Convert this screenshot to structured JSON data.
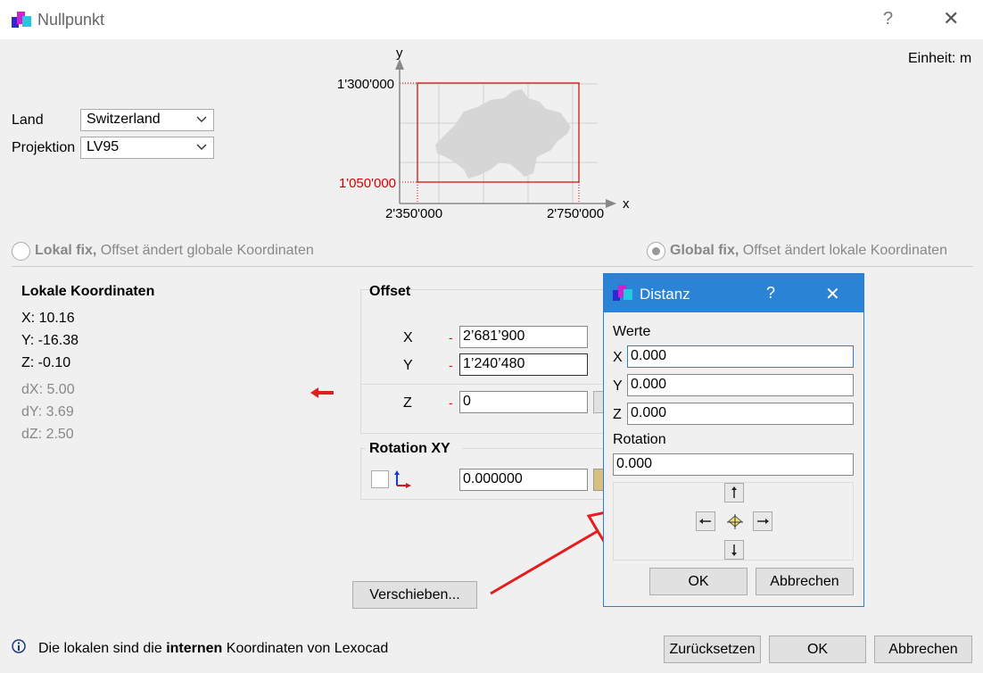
{
  "window": {
    "title": "Nullpunkt",
    "help": "?",
    "close": "✕"
  },
  "unit": "Einheit: m",
  "land": {
    "label": "Land",
    "value": "Switzerland"
  },
  "projektion": {
    "label": "Projektion",
    "value": "LV95"
  },
  "map": {
    "y_axis": "y",
    "x_axis": "x",
    "y_top": "1'300'000",
    "y_bottom": "1'050'000",
    "x_left": "2'350'000",
    "x_right": "2'750'000",
    "colors": {
      "frame": "#d40000",
      "country": "#d6d6d6",
      "grid": "#cfcfcf"
    }
  },
  "modes": {
    "lokal": {
      "bold": "Lokal fix,",
      "rest": " Offset ändert globale Koordinaten",
      "checked": false
    },
    "global": {
      "bold": "Global fix,",
      "rest": " Offset ändert lokale Koordinaten",
      "checked": true
    }
  },
  "local_coords": {
    "heading": "Lokale Koordinaten",
    "x": "X: 10.16",
    "y": "Y: -16.38",
    "z": "Z: -0.10",
    "dx": "dX: 5.00",
    "dy": "dY: 3.69",
    "dz": "dZ: 2.50"
  },
  "offset": {
    "heading": "Offset",
    "x_label": "X",
    "y_label": "Y",
    "z_label": "Z",
    "minus": "-",
    "x_value": "2’681’900",
    "y_value": "1’240’480",
    "z_value": "0"
  },
  "rotation": {
    "heading": "Rotation XY",
    "value": "0.000000"
  },
  "buttons": {
    "verschieben": "Verschieben...",
    "reset": "Zurücksetzen",
    "ok": "OK",
    "cancel": "Abbrechen"
  },
  "info": {
    "pre": "Die lokalen sind die ",
    "bold": "internen",
    "post": " Koordinaten von Lexocad"
  },
  "distanz": {
    "title": "Distanz",
    "help": "?",
    "close": "✕",
    "werte": "Werte",
    "x_label": "X",
    "y_label": "Y",
    "z_label": "Z",
    "x_value": "0.000",
    "y_value": "0.000",
    "z_value": "0.000",
    "rotation_label": "Rotation",
    "rotation_value": "0.000",
    "ok": "OK",
    "cancel": "Abbrechen"
  },
  "colors": {
    "accent": "#2b83d6",
    "annotation": "#e31e1e"
  }
}
